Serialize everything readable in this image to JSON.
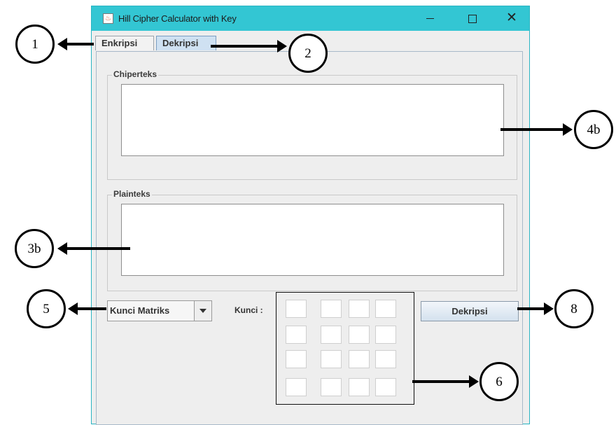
{
  "window": {
    "title": "Hill Cipher Calculator with Key",
    "app_icon_glyph": "♨"
  },
  "tabs": [
    {
      "label": "Enkripsi"
    },
    {
      "label": "Dekripsi",
      "selected": true
    }
  ],
  "sections": {
    "ciphertext_label": "Chiperteks",
    "plaintext_label": "Plainteks"
  },
  "key_matrix_select": {
    "selected": "Kunci Matriks"
  },
  "key_label": "Kunci :",
  "key_matrix": {
    "rows": 4,
    "cols": 4,
    "values": [
      "",
      "",
      "",
      "",
      "",
      "",
      "",
      "",
      "",
      "",
      "",
      "",
      "",
      "",
      "",
      ""
    ]
  },
  "decrypt_button": {
    "label": "Dekripsi"
  },
  "callouts": {
    "c1": "1",
    "c2": "2",
    "c3b": "3b",
    "c4b": "4b",
    "c5": "5",
    "c6": "6",
    "c8": "8"
  },
  "colors": {
    "titlebar": "#33c6d3",
    "selected_tab": "#cfe1f2",
    "panel_bg": "#eeeeee"
  }
}
